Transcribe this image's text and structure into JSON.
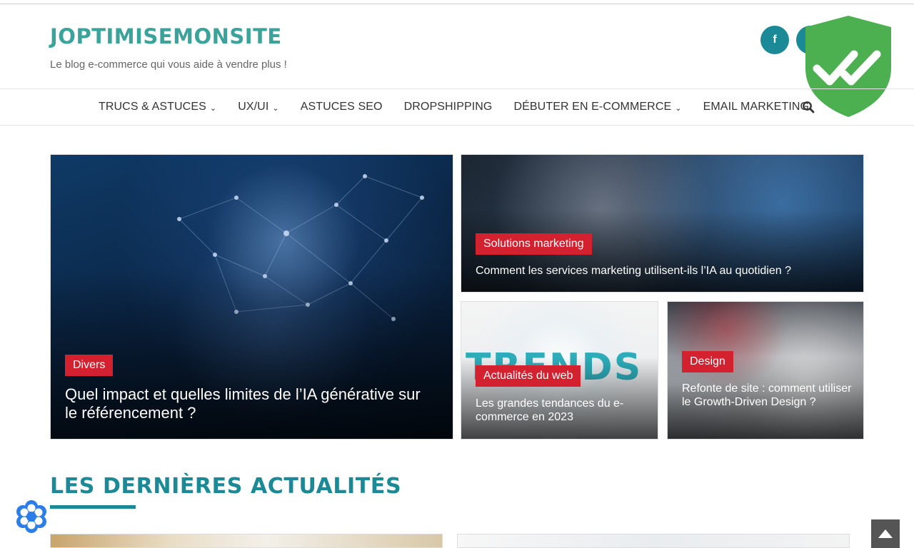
{
  "site": {
    "logo": "JOPTIMISEMONSITE",
    "tagline": "Le blog e-commerce qui vous aide à vendre plus !"
  },
  "social": {
    "facebook_glyph": "f",
    "facebook_icon": "facebook-icon"
  },
  "nav": {
    "items": [
      {
        "label": "TRUCS & ASTUCES",
        "has_dropdown": true
      },
      {
        "label": "UX/UI",
        "has_dropdown": true
      },
      {
        "label": "ASTUCES SEO",
        "has_dropdown": false
      },
      {
        "label": "DROPSHIPPING",
        "has_dropdown": false
      },
      {
        "label": "DÉBUTER EN E-COMMERCE",
        "has_dropdown": true
      },
      {
        "label": "EMAIL MARKETING",
        "has_dropdown": false
      }
    ],
    "chevron": "⌄",
    "search_icon": "search-icon"
  },
  "featured": [
    {
      "category": "Divers",
      "title": "Quel impact et quelles limites de l’IA générative sur le référencement ?"
    },
    {
      "category": "Solutions marketing",
      "title": "Comment les services marketing utilisent-ils l’IA au quotidien ?"
    },
    {
      "category": "Actualités du web",
      "title": "Les grandes tendances du e-commerce en 2023",
      "image_text": "TRENDS"
    },
    {
      "category": "Design",
      "title": "Refonte de site : comment utiliser le Growth-Driven Design ?"
    }
  ],
  "latest": {
    "title": "LES DERNIÈRES ACTUALITÉS"
  },
  "colors": {
    "brand_teal": "#1b8a96",
    "logo_teal": "#3aa39a",
    "tag_red": "#d3212f",
    "shield_green": "#4caf50"
  }
}
